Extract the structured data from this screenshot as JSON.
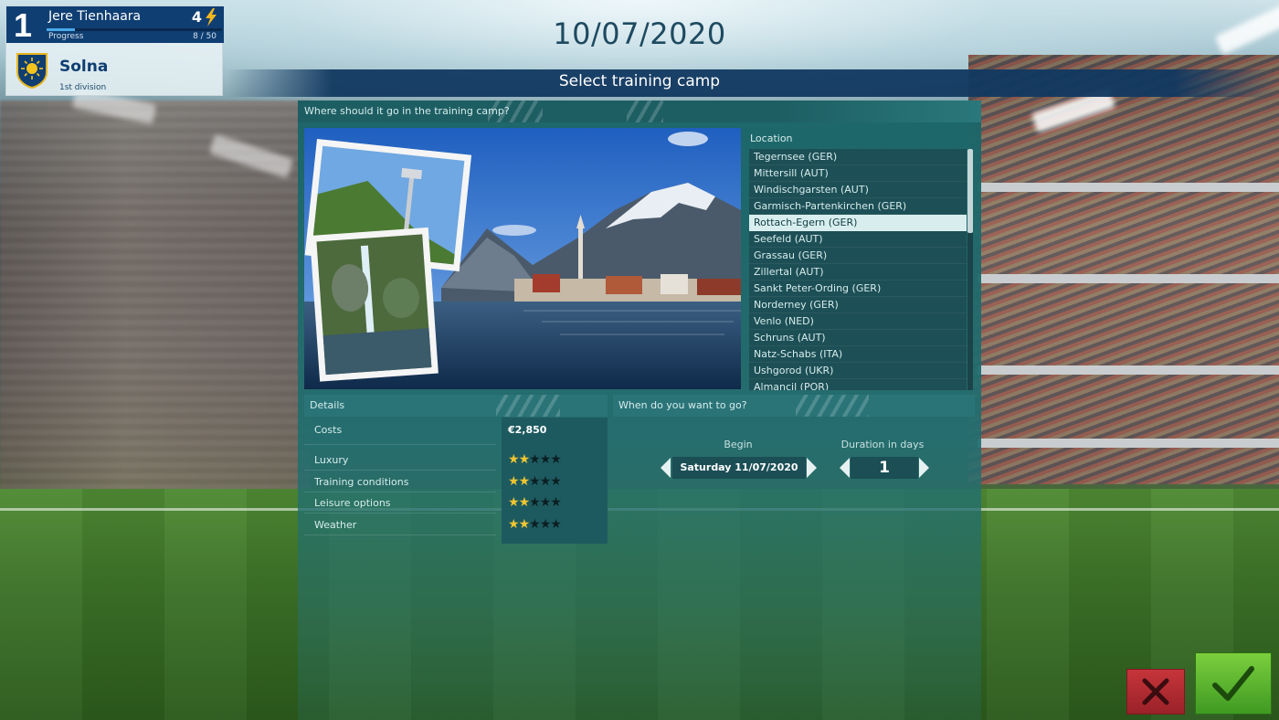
{
  "manager": {
    "rank": "1",
    "name": "Jere Tienhaara",
    "level": "4",
    "progress_label": "Progress",
    "progress_value": "8 / 50",
    "progress_fraction": 0.16,
    "club": "Solna",
    "division": "1st division"
  },
  "header": {
    "date": "10/07/2020",
    "title": "Select training camp"
  },
  "panel": {
    "question": "Where should it go in the training camp?",
    "location_label": "Location",
    "locations": [
      "Tegernsee (GER)",
      "Mittersill (AUT)",
      "Windischgarsten (AUT)",
      "Garmisch-Partenkirchen (GER)",
      "Rottach-Egern (GER)",
      "Seefeld (AUT)",
      "Grassau (GER)",
      "Zillertal (AUT)",
      "Sankt Peter-Ording (GER)",
      "Norderney (GER)",
      "Venlo (NED)",
      "Schruns (AUT)",
      "Natz-Schabs (ITA)",
      "Ushgorod (UKR)",
      "Almancil (POR)"
    ],
    "selected_location_index": 4
  },
  "details": {
    "header": "Details",
    "costs_label": "Costs",
    "costs_value": "€2,850",
    "ratings": [
      {
        "label": "Luxury",
        "stars": 2,
        "max": 5
      },
      {
        "label": "Training conditions",
        "stars": 2,
        "max": 5
      },
      {
        "label": "Leisure options",
        "stars": 2,
        "max": 5
      },
      {
        "label": "Weather",
        "stars": 2,
        "max": 5
      }
    ]
  },
  "schedule": {
    "header": "When do you want to go?",
    "begin_label": "Begin",
    "begin_value": "Saturday 11/07/2020",
    "duration_label": "Duration in days",
    "duration_value": "1"
  },
  "colors": {
    "panel": "#1a6568",
    "selected_row": "#d8eeee",
    "star_on": "#f0c530",
    "cancel": "#c6353a",
    "confirm": "#5db52f",
    "title_band": "#113860"
  },
  "icons": {
    "level": "lightning-bolt-icon",
    "club": "sun-shield-badge-icon",
    "cancel": "x-icon",
    "confirm": "checkmark-icon"
  }
}
